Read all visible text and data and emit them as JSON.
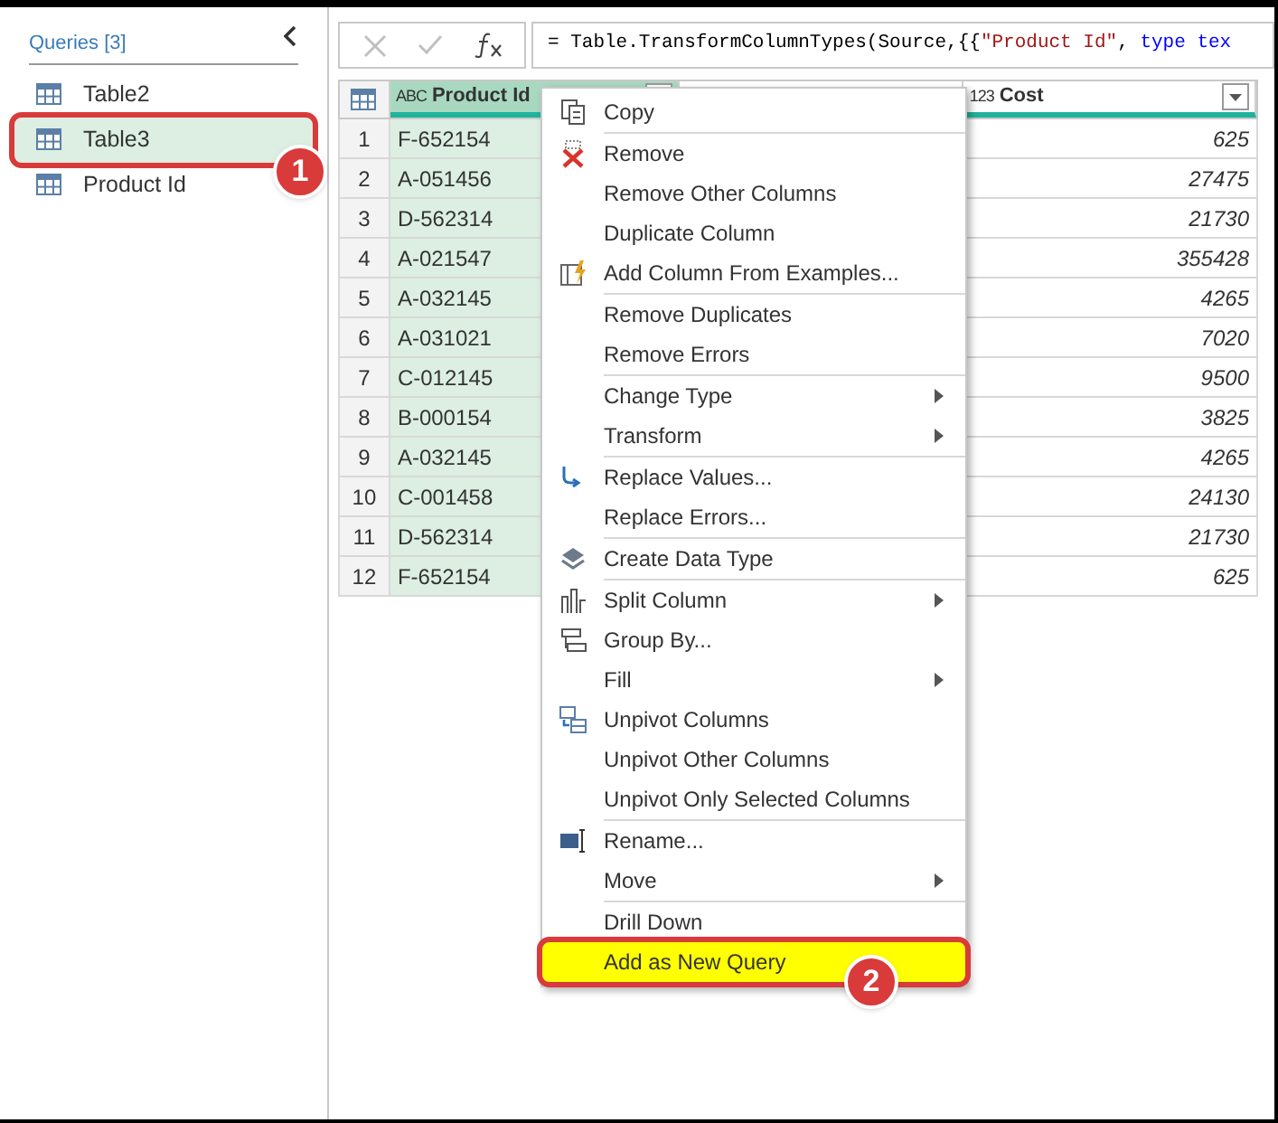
{
  "queries_panel": {
    "title": "Queries [3]",
    "items": [
      {
        "label": "Table2",
        "selected": false
      },
      {
        "label": "Table3",
        "selected": true
      },
      {
        "label": "Product Id",
        "selected": false
      }
    ]
  },
  "formula_bar": {
    "segments": [
      {
        "kind": "plain",
        "text": "= Table.TransformColumnTypes(Source,{{"
      },
      {
        "kind": "string",
        "text": "\"Product Id\""
      },
      {
        "kind": "plain",
        "text": ", "
      },
      {
        "kind": "keyword",
        "text": "type tex"
      }
    ]
  },
  "table": {
    "columns": [
      {
        "type_badge": "ABC",
        "label": "Product Id",
        "selected": true
      },
      {
        "selected": false
      },
      {
        "type_badge": "123",
        "label": "Cost",
        "selected": false
      }
    ],
    "rows": [
      {
        "n": "1",
        "id": "F-652154",
        "cost": "625"
      },
      {
        "n": "2",
        "id": "A-051456",
        "cost": "27475"
      },
      {
        "n": "3",
        "id": "D-562314",
        "cost": "21730"
      },
      {
        "n": "4",
        "id": "A-021547",
        "cost": "355428"
      },
      {
        "n": "5",
        "id": "A-032145",
        "cost": "4265"
      },
      {
        "n": "6",
        "id": "A-031021",
        "cost": "7020"
      },
      {
        "n": "7",
        "id": "C-012145",
        "cost": "9500"
      },
      {
        "n": "8",
        "id": "B-000154",
        "cost": "3825"
      },
      {
        "n": "9",
        "id": "A-032145",
        "cost": "4265"
      },
      {
        "n": "10",
        "id": "C-001458",
        "cost": "24130"
      },
      {
        "n": "11",
        "id": "D-562314",
        "cost": "21730"
      },
      {
        "n": "12",
        "id": "F-652154",
        "cost": "625"
      }
    ]
  },
  "context_menu": {
    "groups": [
      [
        {
          "label": "Copy",
          "submenu": false,
          "highlighted": false
        }
      ],
      [
        {
          "label": "Remove",
          "submenu": false,
          "highlighted": false
        },
        {
          "label": "Remove Other Columns",
          "submenu": false,
          "highlighted": false
        },
        {
          "label": "Duplicate Column",
          "submenu": false,
          "highlighted": false
        },
        {
          "label": "Add Column From Examples...",
          "submenu": false,
          "highlighted": false
        }
      ],
      [
        {
          "label": "Remove Duplicates",
          "submenu": false,
          "highlighted": false
        },
        {
          "label": "Remove Errors",
          "submenu": false,
          "highlighted": false
        }
      ],
      [
        {
          "label": "Change Type",
          "submenu": true,
          "highlighted": false
        },
        {
          "label": "Transform",
          "submenu": true,
          "highlighted": false
        }
      ],
      [
        {
          "label": "Replace Values...",
          "submenu": false,
          "highlighted": false
        },
        {
          "label": "Replace Errors...",
          "submenu": false,
          "highlighted": false
        }
      ],
      [
        {
          "label": "Create Data Type",
          "submenu": false,
          "highlighted": false
        }
      ],
      [
        {
          "label": "Split Column",
          "submenu": true,
          "highlighted": false
        },
        {
          "label": "Group By...",
          "submenu": false,
          "highlighted": false
        },
        {
          "label": "Fill",
          "submenu": true,
          "highlighted": false
        },
        {
          "label": "Unpivot Columns",
          "submenu": false,
          "highlighted": false
        },
        {
          "label": "Unpivot Other Columns",
          "submenu": false,
          "highlighted": false
        },
        {
          "label": "Unpivot Only Selected Columns",
          "submenu": false,
          "highlighted": false
        }
      ],
      [
        {
          "label": "Rename...",
          "submenu": false,
          "highlighted": false
        },
        {
          "label": "Move",
          "submenu": true,
          "highlighted": false
        }
      ],
      [
        {
          "label": "Drill Down",
          "submenu": false,
          "highlighted": false
        },
        {
          "label": "Add as New Query",
          "submenu": false,
          "highlighted": true
        }
      ]
    ]
  },
  "callouts": [
    "1",
    "2"
  ]
}
